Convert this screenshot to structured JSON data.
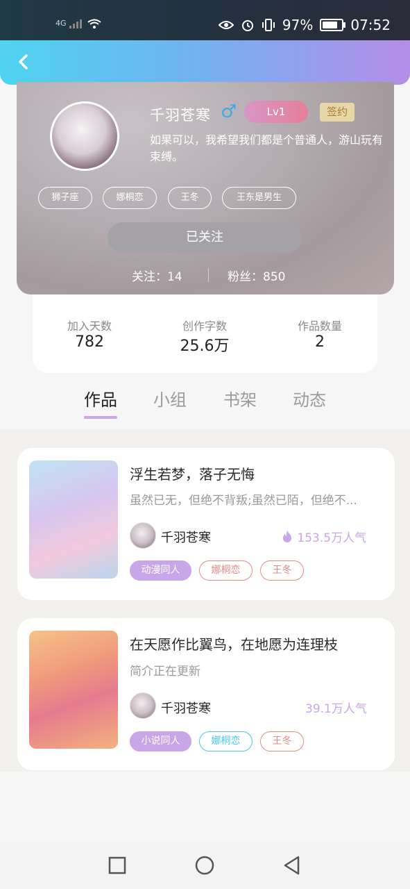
{
  "status_bar": {
    "network": "4G",
    "battery": "97%",
    "battery_level": 0.97,
    "time": "07:52",
    "icons": [
      "signal-icon",
      "wifi-icon",
      "eye-icon",
      "alarm-icon",
      "vibrate-icon",
      "battery-icon"
    ]
  },
  "header": {
    "back_icon": "chevron-left-icon"
  },
  "profile": {
    "username": "千羽苍寒",
    "gender_symbol": "♂",
    "level": "Lv1",
    "signed_badge": "签约",
    "bio": "如果可以，我希望我们都是个普通人，游山玩有束缚。",
    "tags": [
      "狮子座",
      "娜桐恋",
      "王冬",
      "王东是男生"
    ],
    "follow_button": "已关注",
    "following": "关注：14",
    "fans": "粉丝：850"
  },
  "stats": [
    {
      "label": "加入天数",
      "value": "782"
    },
    {
      "label": "创作字数",
      "value": "25.6万"
    },
    {
      "label": "作品数量",
      "value": "2"
    }
  ],
  "tabs": [
    {
      "label": "作品",
      "active": true
    },
    {
      "label": "小组",
      "active": false
    },
    {
      "label": "书架",
      "active": false
    },
    {
      "label": "动态",
      "active": false
    }
  ],
  "works": [
    {
      "title": "浮生若梦，落子无悔",
      "description": "虽然已无，但绝不背叛;虽然已陌，但绝不...",
      "author": "千羽苍寒",
      "popularity": "153.5万人气",
      "hot": true,
      "tags": [
        "动漫同人",
        "娜桐恋",
        "王冬"
      ]
    },
    {
      "title": "在天愿作比翼鸟，在地愿为连理枝",
      "description": "简介正在更新",
      "author": "千羽苍寒",
      "popularity": "39.1万人气",
      "hot": false,
      "tags": [
        "小说同人",
        "娜桐恋",
        "王冬"
      ]
    }
  ],
  "nav_bar": {
    "icons": [
      "recent-apps-icon",
      "home-icon",
      "back-icon"
    ]
  },
  "colors": {
    "accent": "#c9a6e8",
    "header_start": "#4fd3f0",
    "header_end": "#b58de8",
    "tag_red": "#e58a8a",
    "tag_cyan": "#4fc6e0"
  }
}
